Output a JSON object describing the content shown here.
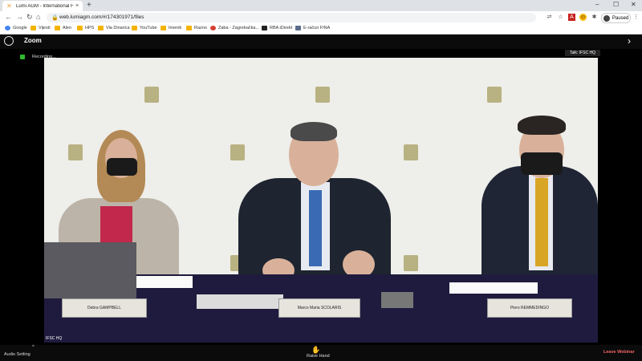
{
  "browser": {
    "tab_title": "Lumi AGM - International Federati",
    "tab_close": "×",
    "new_tab": "+",
    "window_controls": [
      "–",
      "☐",
      "✕"
    ],
    "url": "web.lumiagm.com/#/174301971/files",
    "profile_label": "Paused",
    "bookmarks": [
      {
        "label": "Google",
        "color": "#4285f4"
      },
      {
        "label": "Vijesti",
        "color": "#f4b400"
      },
      {
        "label": "Alen",
        "color": "#f4b400"
      },
      {
        "label": "HPS",
        "color": "#f4b400"
      },
      {
        "label": "Via Dinarica",
        "color": "#f4b400"
      },
      {
        "label": "YouTube",
        "color": "#f4b400"
      },
      {
        "label": "Imenik",
        "color": "#f4b400"
      },
      {
        "label": "Razno",
        "color": "#f4b400"
      },
      {
        "label": "Zaba - Zagrebačka...",
        "color": "#d23f31"
      },
      {
        "label": "RBA iDirekt",
        "color": "#222222"
      },
      {
        "label": "E-račun FINA",
        "color": "#5b6b8c"
      }
    ]
  },
  "zoom": {
    "title": "Zoom",
    "recording": "Recording...",
    "talking": "Talk: IFSC HQ",
    "participant_name": "IFSC HQ",
    "audio_setting": "Audio Setting",
    "raise_hand": "Raise Hand",
    "leave": "Leave Webinar"
  },
  "video": {
    "nameplates": [
      "Debra GAMPBELL",
      "Marco Maria SCOLARIS",
      "Piero REMMEDINGO"
    ]
  },
  "colors": {
    "backdrop": "#eeeeea",
    "table_cloth": "#1f1b3e",
    "leave_text": "#f06464"
  }
}
